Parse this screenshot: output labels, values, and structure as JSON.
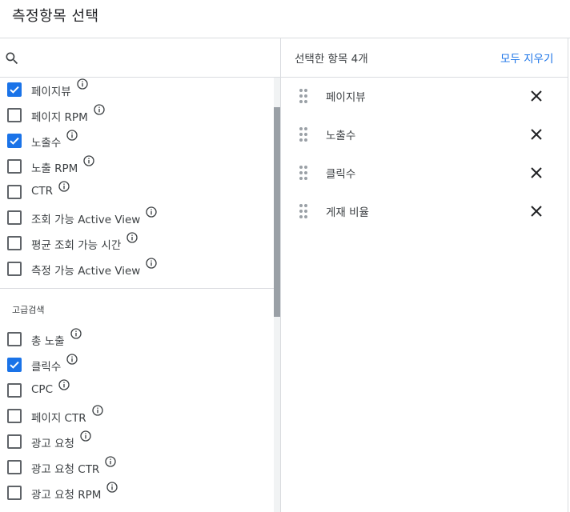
{
  "dialog": {
    "title": "측정항목 선택"
  },
  "search": {
    "placeholder": "",
    "value": ""
  },
  "metrics_basic": [
    {
      "label": "페이지뷰",
      "checked": true
    },
    {
      "label": "페이지 RPM",
      "checked": false
    },
    {
      "label": "노출수",
      "checked": true
    },
    {
      "label": "노출 RPM",
      "checked": false
    },
    {
      "label": "CTR",
      "checked": false
    },
    {
      "label": "조회 가능 Active View",
      "checked": false
    },
    {
      "label": "평균 조회 가능 시간",
      "checked": false
    },
    {
      "label": "측정 가능 Active View",
      "checked": false
    }
  ],
  "advanced": {
    "title": "고급검색",
    "items": [
      {
        "label": "총 노출",
        "checked": false
      },
      {
        "label": "클릭수",
        "checked": true
      },
      {
        "label": "CPC",
        "checked": false
      },
      {
        "label": "페이지 CTR",
        "checked": false
      },
      {
        "label": "광고 요청",
        "checked": false
      },
      {
        "label": "광고 요청 CTR",
        "checked": false
      },
      {
        "label": "광고 요청 RPM",
        "checked": false
      }
    ]
  },
  "selected": {
    "count_label": "선택한 항목 4개",
    "clear_label": "모두 지우기",
    "items": [
      "페이지뷰",
      "노출수",
      "클릭수",
      "게재 비율"
    ]
  },
  "icons": {
    "search": "search-icon",
    "info": "info-icon",
    "drag": "drag-handle-icon",
    "remove": "close-icon"
  },
  "colors": {
    "accent": "#1a73e8",
    "text": "#3c4043",
    "divider": "#dadce0"
  }
}
